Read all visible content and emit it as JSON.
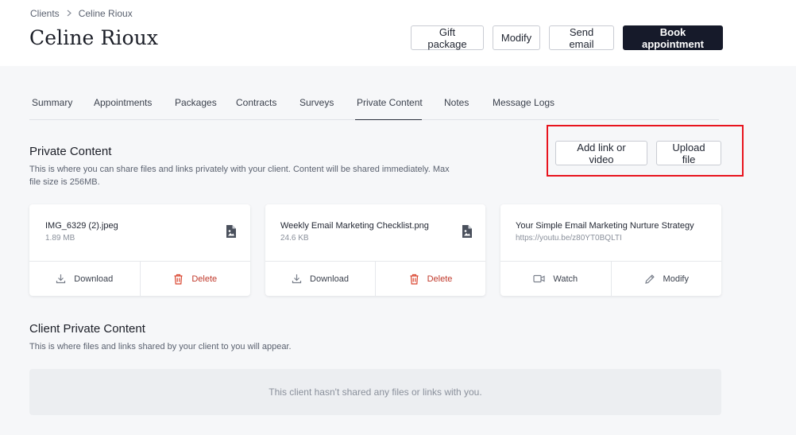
{
  "breadcrumb": {
    "parent": "Clients",
    "current": "Celine Rioux"
  },
  "header": {
    "title": "Celine Rioux",
    "buttons": {
      "gift_package": "Gift package",
      "modify": "Modify",
      "send_email": "Send email",
      "book_appointment": "Book appointment"
    }
  },
  "tabs": [
    {
      "label": "Summary",
      "active": false
    },
    {
      "label": "Appointments",
      "active": false
    },
    {
      "label": "Packages",
      "active": false
    },
    {
      "label": "Contracts",
      "active": false
    },
    {
      "label": "Surveys",
      "active": false
    },
    {
      "label": "Private Content",
      "active": true
    },
    {
      "label": "Notes",
      "active": false
    },
    {
      "label": "Message Logs",
      "active": false
    }
  ],
  "private_content": {
    "title": "Private Content",
    "description": "This is where you can share files and links privately with your client. Content will be shared immediately. Max file size is 256MB.",
    "add_link_label": "Add link or video",
    "upload_label": "Upload file",
    "items": [
      {
        "name": "IMG_6329 (2).jpeg",
        "meta": "1.89 MB",
        "icon": "image-file-icon",
        "actions": [
          "Download",
          "Delete"
        ]
      },
      {
        "name": "Weekly Email Marketing Checklist.png",
        "meta": "24.6 KB",
        "icon": "image-file-icon",
        "actions": [
          "Download",
          "Delete"
        ]
      },
      {
        "name": "Your Simple Email Marketing Nurture Strategy",
        "meta": "https://youtu.be/z80YT0BQLTI",
        "icon": "",
        "actions": [
          "Watch",
          "Modify"
        ]
      }
    ]
  },
  "client_private_content": {
    "title": "Client Private Content",
    "description": "This is where files and links shared by your client to you will appear.",
    "empty_message": "This client hasn't shared any files or links with you."
  },
  "colors": {
    "primary": "#161a2a",
    "danger": "#c0392b",
    "highlight": "#e8141e",
    "background": "#f6f7f9"
  }
}
